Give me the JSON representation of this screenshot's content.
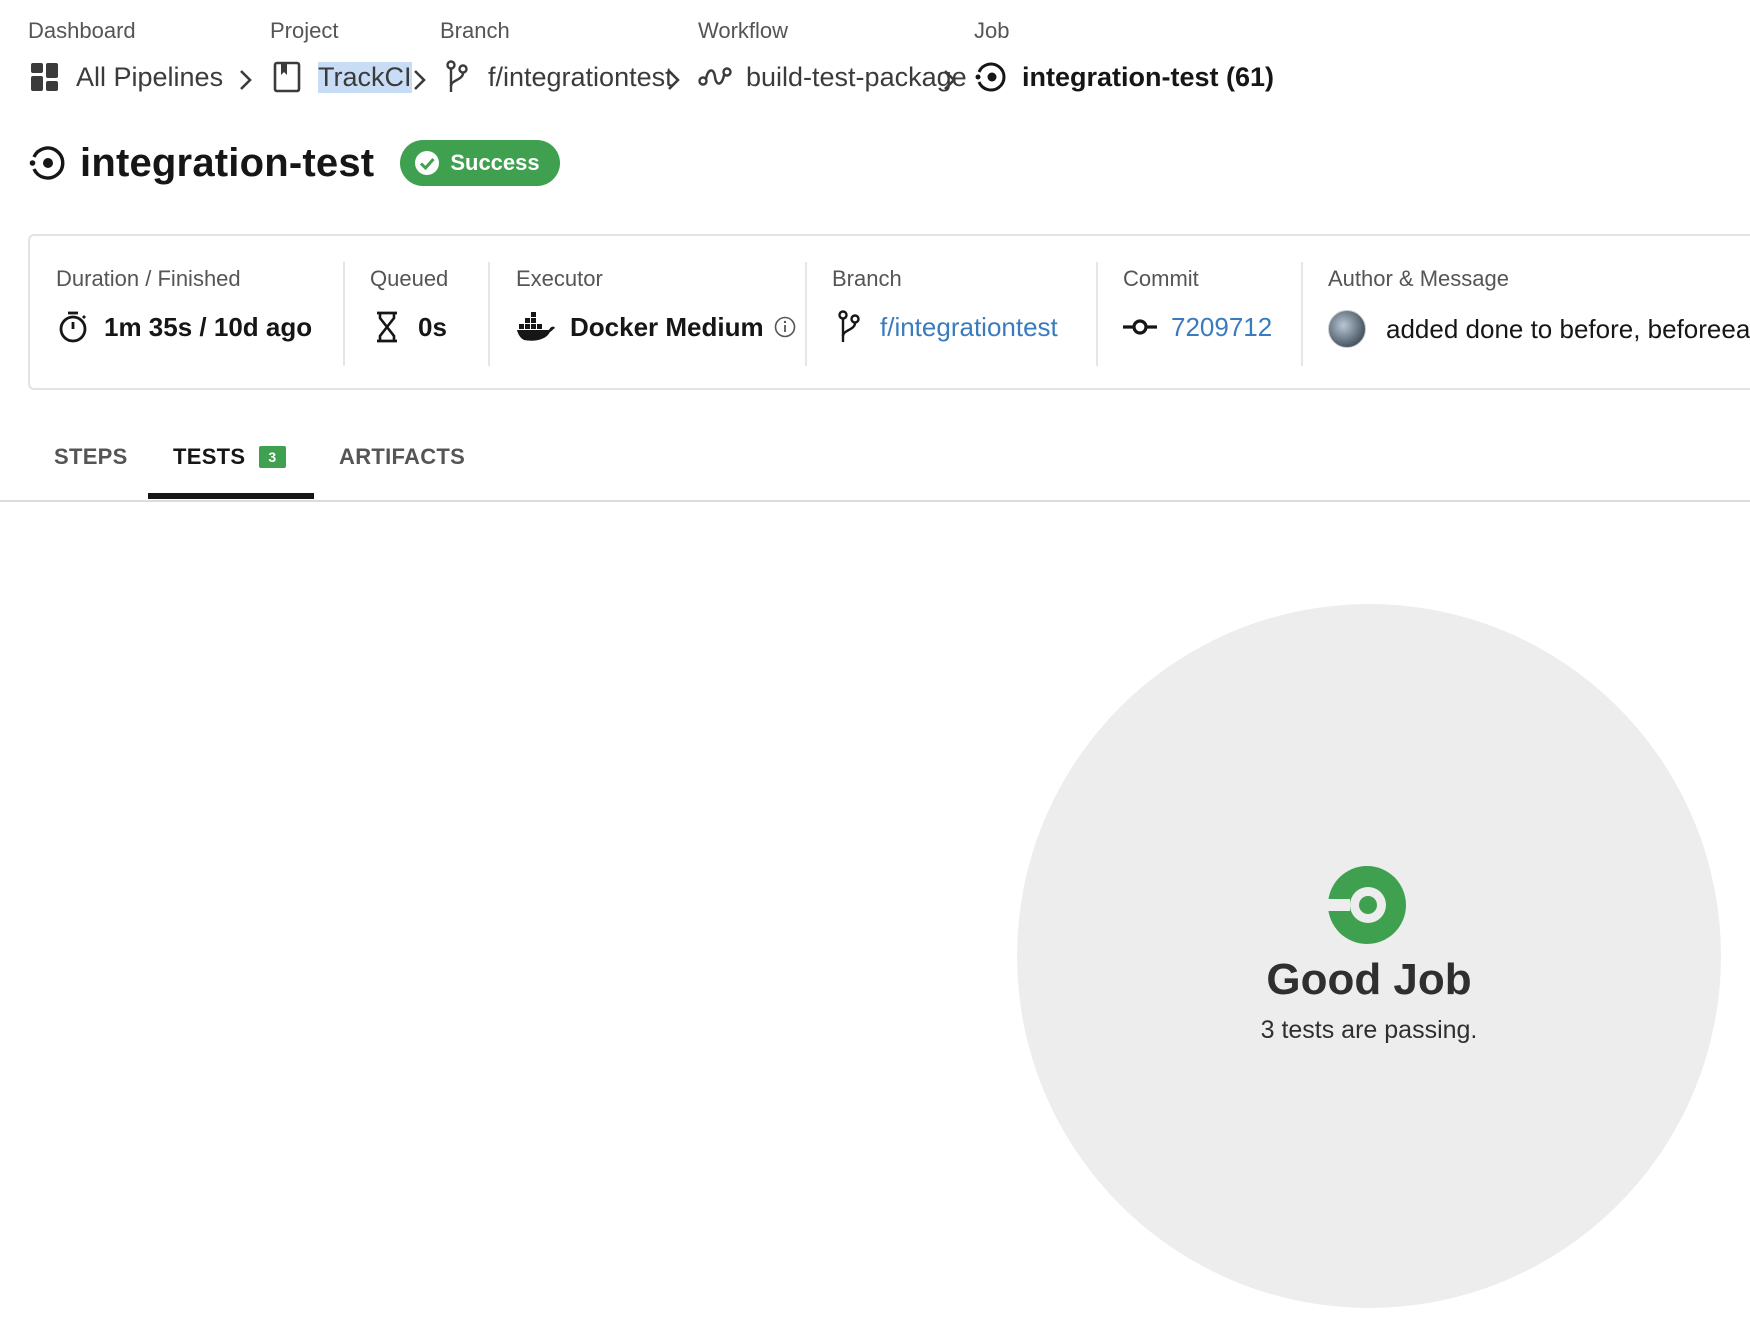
{
  "breadcrumb": {
    "dashboard": {
      "label": "Dashboard",
      "link": "All Pipelines",
      "icon": "dashboard-grid-icon"
    },
    "project": {
      "label": "Project",
      "link": "TrackCI",
      "icon": "bookmark-project-icon"
    },
    "branch": {
      "label": "Branch",
      "link": "f/integrationtest",
      "icon": "git-branch-icon"
    },
    "workflow": {
      "label": "Workflow",
      "link": "build-test-package",
      "icon": "workflow-icon"
    },
    "job": {
      "label": "Job",
      "link": "integration-test (61)",
      "icon": "job-icon"
    }
  },
  "header": {
    "title": "integration-test",
    "status": "Success",
    "status_color": "#3fa14f"
  },
  "info": {
    "duration": {
      "label": "Duration / Finished",
      "value": "1m 35s / 10d ago",
      "icon": "stopwatch-icon"
    },
    "queued": {
      "label": "Queued",
      "value": "0s",
      "icon": "hourglass-icon"
    },
    "executor": {
      "label": "Executor",
      "value": "Docker Medium",
      "icon": "docker-icon"
    },
    "branch": {
      "label": "Branch",
      "value": "f/integrationtest",
      "icon": "git-branch-icon"
    },
    "commit": {
      "label": "Commit",
      "value": "7209712",
      "icon": "commit-icon"
    },
    "author": {
      "label": "Author & Message",
      "value": "added done to before, beforeea"
    }
  },
  "tabs": [
    {
      "label": "STEPS"
    },
    {
      "label": "TESTS",
      "count": "3"
    },
    {
      "label": "ARTIFACTS"
    }
  ],
  "empty_state": {
    "title": "Good Job",
    "message": "3 tests are passing."
  },
  "colors": {
    "accent_green": "#3fa14f",
    "link_blue": "#3a7bbf"
  }
}
